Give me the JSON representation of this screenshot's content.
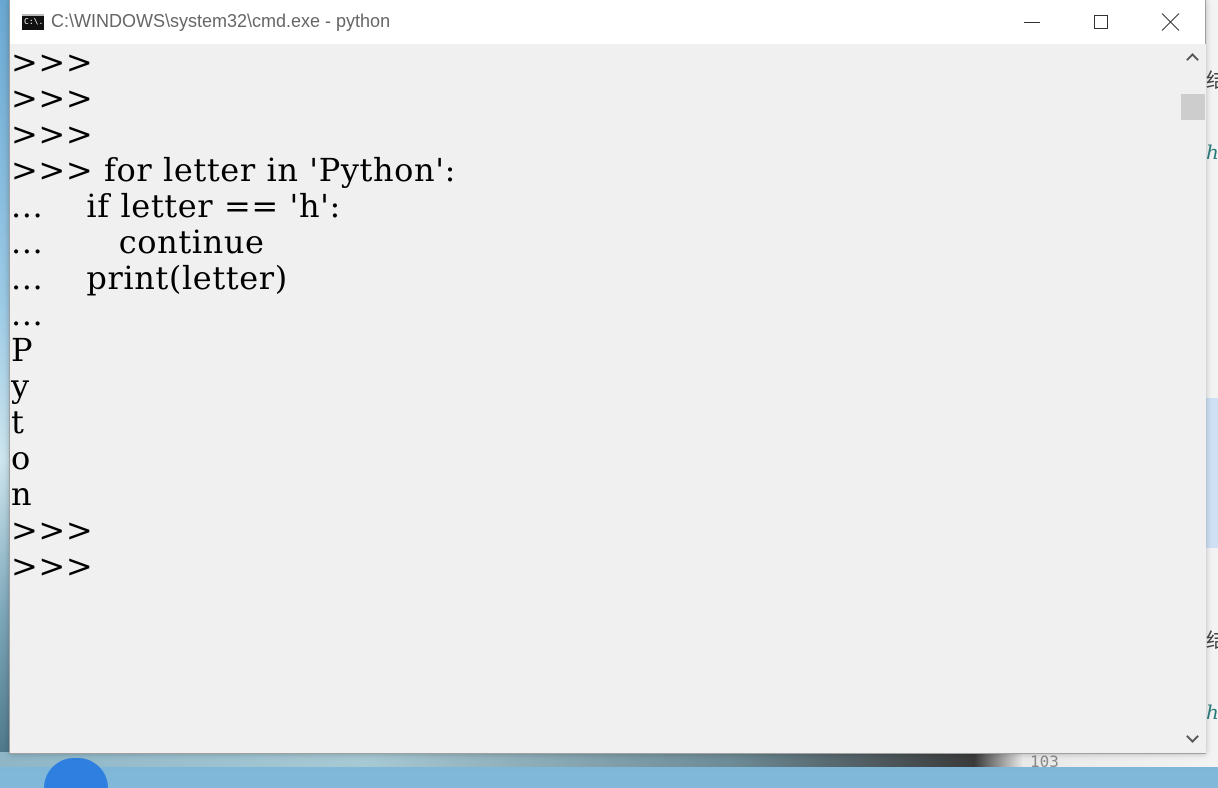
{
  "window": {
    "title": "C:\\WINDOWS\\system32\\cmd.exe - python",
    "icon": "cmd-icon",
    "icon_text": "C:\\."
  },
  "controls": {
    "minimize_icon": "minimize-icon",
    "maximize_icon": "maximize-icon",
    "close_icon": "close-icon"
  },
  "console": {
    "lines": [
      ">>>",
      ">>>",
      ">>>",
      ">>> for letter in 'Python':",
      "...    if letter == 'h':",
      "...       continue",
      "...    print(letter)",
      "...",
      "P",
      "y",
      "t",
      "o",
      "n",
      ">>>",
      ">>>"
    ]
  },
  "background": {
    "page_number": "103"
  }
}
